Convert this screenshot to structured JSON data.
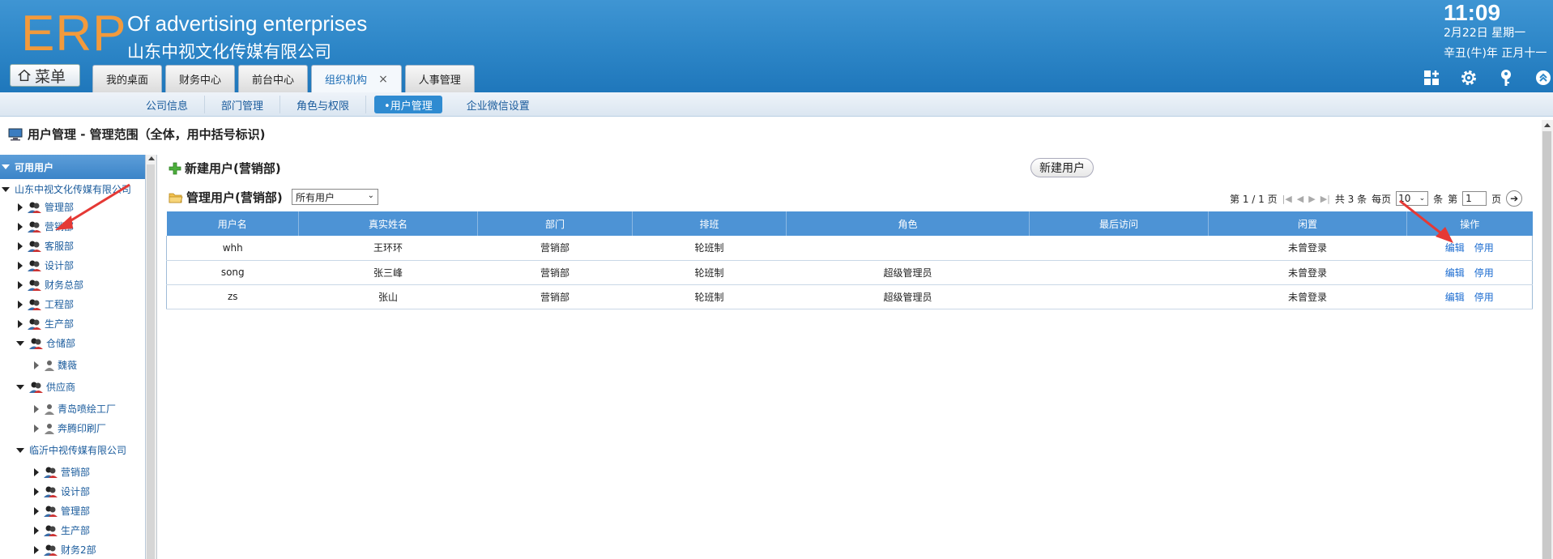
{
  "header": {
    "logo": "ERP",
    "company_en": "Of advertising enterprises",
    "company_cn": "山东中视文化传媒有限公司",
    "time": "11:09",
    "date": "2月22日 星期一",
    "lunar": "辛丑(牛)年 正月十一",
    "menu_label": "菜单",
    "tabs": [
      {
        "label": "我的桌面"
      },
      {
        "label": "财务中心"
      },
      {
        "label": "前台中心"
      },
      {
        "label": "组织机构",
        "close": "×"
      },
      {
        "label": "人事管理"
      }
    ],
    "icons": [
      "apps-icon",
      "gear-icon",
      "key-icon",
      "collapse-icon"
    ]
  },
  "subnav": {
    "items": [
      "公司信息",
      "部门管理",
      "角色与权限",
      "•用户管理",
      "企业微信设置"
    ]
  },
  "page": {
    "title": "用户管理 - 管理范围（全体，用中括号标识)"
  },
  "tree": {
    "header": "可用用户",
    "root": "山东中视文化传媒有限公司",
    "items": [
      "管理部",
      "营销部",
      "客服部",
      "设计部",
      "财务总部",
      "工程部",
      "生产部",
      "仓储部",
      "魏薇",
      "供应商",
      "青岛喷绘工厂",
      "奔腾印刷厂"
    ],
    "company2": "临沂中视传媒有限公司",
    "items2": [
      "营销部",
      "设计部",
      "管理部",
      "生产部",
      "财务2部"
    ]
  },
  "main": {
    "new_user_title": "新建用户(营销部)",
    "new_user_button": "新建用户",
    "manage_title": "管理用户(营销部)",
    "filter_value": "所有用户",
    "pager": {
      "page_info": "第 1 / 1 页",
      "total": "共 3 条",
      "per_page_label": "每页",
      "per_page": "10",
      "unit": "条",
      "goto_label": "第",
      "goto_value": "1",
      "page_unit": "页"
    },
    "columns": [
      "用户名",
      "真实姓名",
      "部门",
      "排班",
      "角色",
      "最后访问",
      "闲置",
      "操作"
    ],
    "rows": [
      {
        "username": "whh",
        "realname": "王环环",
        "dept": "营销部",
        "shift": "轮班制",
        "role": "",
        "last": "",
        "idle": "未曾登录",
        "edit": "编辑",
        "disable": "停用"
      },
      {
        "username": "song",
        "realname": "张三峰",
        "dept": "营销部",
        "shift": "轮班制",
        "role": "超级管理员",
        "last": "",
        "idle": "未曾登录",
        "edit": "编辑",
        "disable": "停用"
      },
      {
        "username": "zs",
        "realname": "张山",
        "dept": "营销部",
        "shift": "轮班制",
        "role": "超级管理员",
        "last": "",
        "idle": "未曾登录",
        "edit": "编辑",
        "disable": "停用"
      }
    ]
  },
  "colors": {
    "header_blue": "#2f88c9",
    "logo_orange": "#f29a3c",
    "table_header": "#4d93d5",
    "link_blue": "#1a6bd0",
    "annotation_red": "#e53935"
  }
}
